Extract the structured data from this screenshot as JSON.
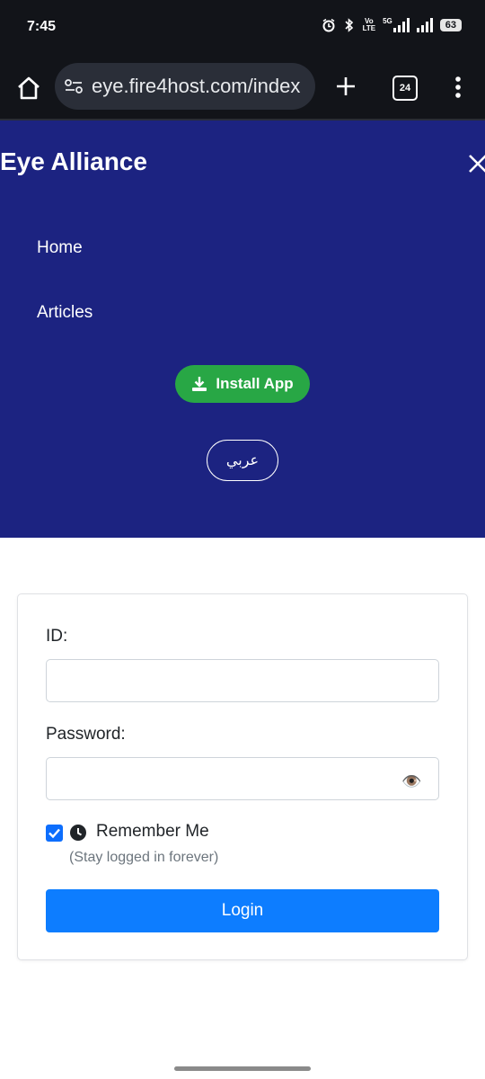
{
  "status_bar": {
    "time": "7:45",
    "network_vo": "Vo",
    "network_lte": "LTE",
    "network_5g": "5G",
    "battery": "63"
  },
  "browser": {
    "url": "eye.fire4host.com/index",
    "tab_count": "24"
  },
  "nav": {
    "brand": "Eye Alliance",
    "items": [
      {
        "label": "Home"
      },
      {
        "label": "Articles"
      }
    ],
    "install_label": "Install App",
    "language_label": "عربي"
  },
  "login": {
    "id_label": "ID:",
    "id_value": "",
    "password_label": "Password:",
    "password_value": "",
    "remember_label": "Remember Me",
    "remember_hint": "(Stay logged in forever)",
    "remember_checked": true,
    "submit_label": "Login"
  },
  "colors": {
    "nav_background": "#1c2381",
    "install_button": "#28a745",
    "login_button": "#0d7dff",
    "checkbox": "#0d6efd",
    "browser_chrome": "#121419"
  }
}
